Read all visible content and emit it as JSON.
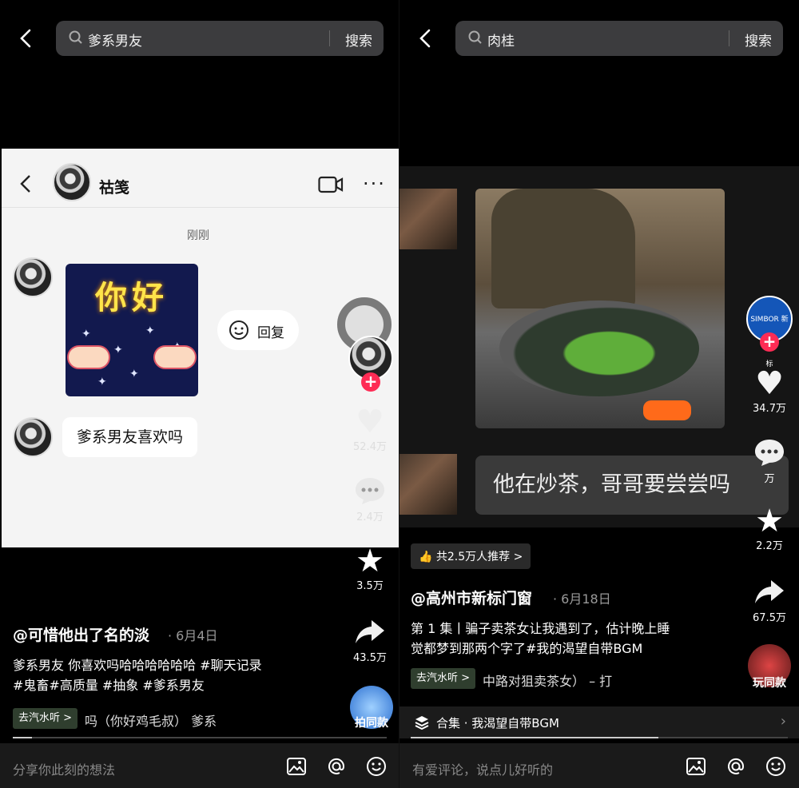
{
  "left": {
    "search": {
      "query": "爹系男友",
      "button": "搜索"
    },
    "chat": {
      "contact_name": "祜笺",
      "time": "刚刚",
      "sticker_text": "你好",
      "reply_label": "回复",
      "message": "爹系男友喜欢吗"
    },
    "actions": {
      "likes": "52.4万",
      "comments": "2.4万",
      "favorites": "3.5万",
      "shares": "43.5万",
      "remix": "拍同款"
    },
    "author": "@可惜他出了名的淡",
    "date": "· 6月4日",
    "desc_line1": "爹系男友 你喜欢吗哈哈哈哈哈哈 #聊天记录",
    "desc_line2": "#鬼畜#高质量 #抽象 #爹系男友",
    "qishui": "去汽水听 >",
    "music": "吗（你好鸡毛叔）  爹系",
    "comment_placeholder": "分享你此刻的想法"
  },
  "right": {
    "search": {
      "query": "肉桂",
      "button": "搜索"
    },
    "caption": "他在炒茶，哥哥要尝尝吗",
    "brand_avatar": "SIMBOR 新标",
    "actions": {
      "likes": "34.7万",
      "comments": "万",
      "favorites": "2.2万",
      "shares": "67.5万",
      "remix": "玩同款"
    },
    "recommend": "共2.5万人推荐 >",
    "author": "@高州市新标门窗",
    "date": "· 6月18日",
    "desc_line1": "第 1 集丨骗子卖茶女让我遇到了，估计晚上睡",
    "desc_line2": "觉都梦到那两个字了#我的渴望自带BGM",
    "qishui": "去汽水听 >",
    "music": "中路对狙卖茶女） – 打",
    "collection": "合集 · 我渴望自带BGM",
    "comment_placeholder": "有爱评论，说点儿好听的"
  }
}
